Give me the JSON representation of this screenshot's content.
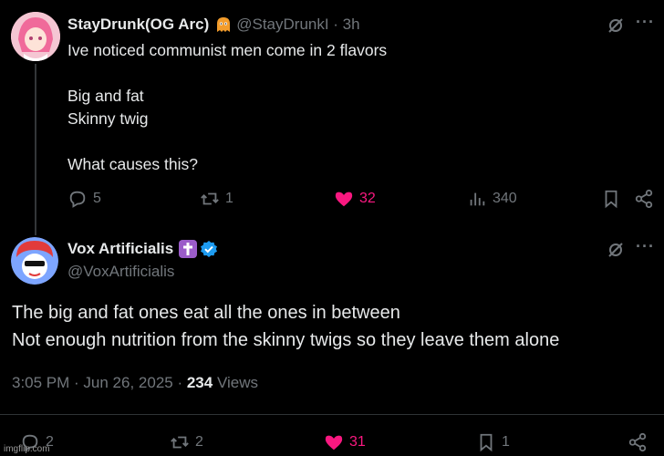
{
  "tweet1": {
    "display_name": "StayDrunk(OG Arc)",
    "handle_time": "@StayDrunkI · 3h",
    "lines": [
      "Ive noticed communist men come in 2 flavors",
      "",
      "Big and fat",
      "Skinny twig",
      "",
      "What causes this?"
    ],
    "replies": "5",
    "retweets": "1",
    "likes": "32",
    "views": "340"
  },
  "tweet2": {
    "display_name": "Vox Artificialis",
    "handle": "@VoxArtificialis",
    "line1": "The big and fat ones eat all the ones in between",
    "line2": "Not enough nutrition from the skinny twigs so they leave them alone",
    "time_date": "3:05 PM · Jun 26, 2025 · ",
    "views_count": "234",
    "views_label": "Views",
    "replies": "2",
    "retweets": "2",
    "likes": "31",
    "bookmarks": "1"
  },
  "colors": {
    "like": "#f91880",
    "verified": "#1d9bf0",
    "muted": "#71767b"
  },
  "watermark": "imgflip.com"
}
